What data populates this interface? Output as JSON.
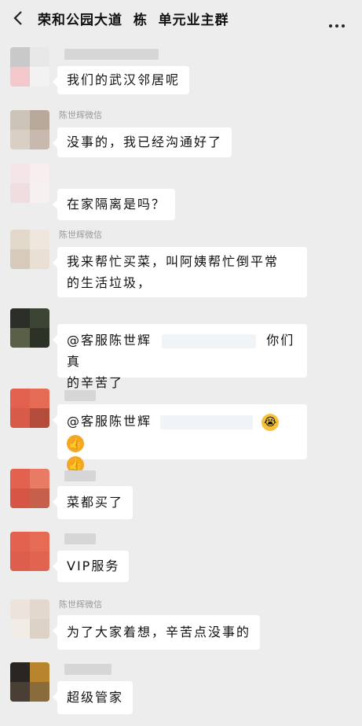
{
  "header": {
    "title": "荣和公园大道  栋  单元业主群",
    "back_icon": "chevron-left-icon",
    "more_icon": "more-dots-icon"
  },
  "messages": [
    {
      "sender": "",
      "text": "我们的武汉邻居呢"
    },
    {
      "sender": "陈世辉微信",
      "text": "没事的，我已经沟通好了"
    },
    {
      "sender": "",
      "text": "在家隔离是吗？"
    },
    {
      "sender": "陈世辉微信",
      "line1": "我来帮忙买菜，叫阿姨帮忙倒平常",
      "line2": "的生活垃圾，"
    },
    {
      "sender": "",
      "line1_a": "@客服陈世辉",
      "line1_b": "你们真",
      "line2": "的辛苦了"
    },
    {
      "sender": "",
      "line1": "@客服陈世辉",
      "emoji1": "😭",
      "emoji2": "👍",
      "emoji3": "👍"
    },
    {
      "sender": "",
      "text": "菜都买了"
    },
    {
      "sender": "",
      "text": "VIP服务"
    },
    {
      "sender": "陈世辉微信",
      "text": "为了大家着想，辛苦点没事的"
    },
    {
      "sender": "",
      "text": "超级管家"
    }
  ]
}
